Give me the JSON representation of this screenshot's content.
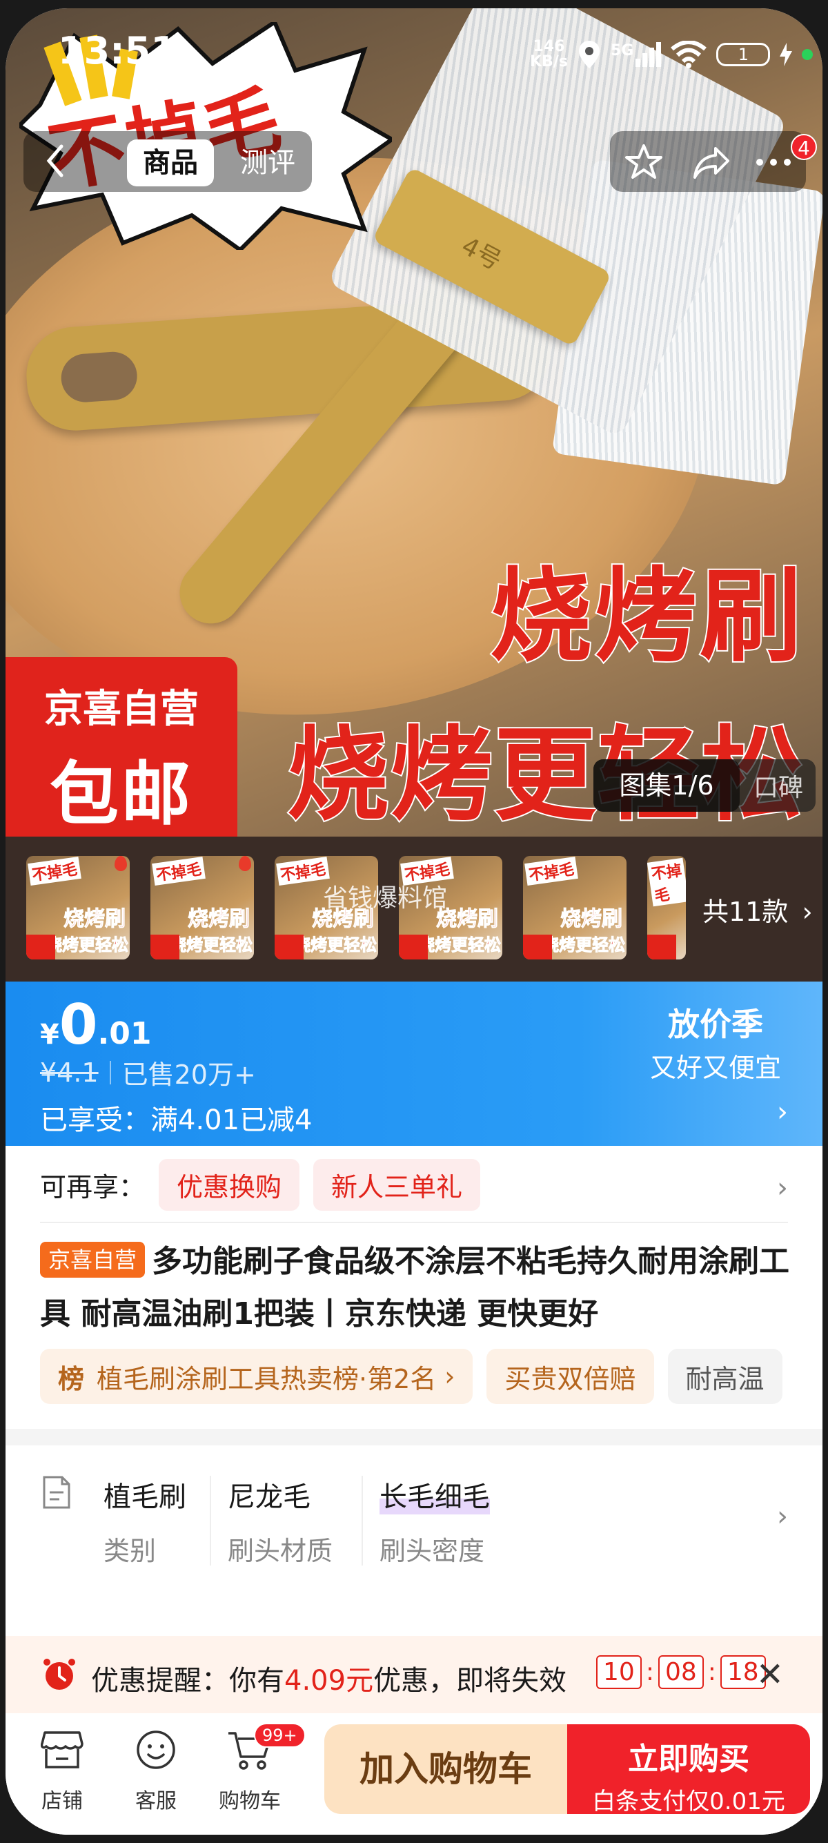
{
  "status": {
    "time": "13:51",
    "speed_value": "146",
    "speed_unit": "KB/s",
    "network": "5G",
    "battery": "1"
  },
  "hero": {
    "burst_text": "不掉毛",
    "headline1": "烧烤刷",
    "headline2": "烧烤更轻松",
    "brush_mark": "4号",
    "promo_line1": "京喜自营",
    "promo_line2": "包邮",
    "gallery_label": "图集1/6",
    "reviews_label": "口碑"
  },
  "topbar": {
    "tab_product": "商品",
    "tab_review": "测评",
    "notif_count": "4"
  },
  "sku": {
    "overlay": "省钱爆料馆",
    "count_label": "共11款",
    "thumb_tag": "不掉毛",
    "thumb_red1": "烧烤刷",
    "thumb_red2": "烧烤更轻松"
  },
  "price": {
    "yen": "¥",
    "integer": "0",
    "decimal": ".01",
    "original": "¥4.1",
    "sold": "已售20万+",
    "promo": "已享受：满4.01已减4",
    "season_title": "放价季",
    "season_sub": "又好又便宜"
  },
  "again": {
    "label": "可再享：",
    "tags": [
      "优惠换购",
      "新人三单礼"
    ]
  },
  "product": {
    "tag": "京喜自营",
    "title": "多功能刷子食品级不涂层不粘毛持久耐用涂刷工具 耐高温油刷1把装丨京东快递 更快更好"
  },
  "rank": {
    "bang": "榜",
    "rank_text": "植毛刷涂刷工具热卖榜·第2名",
    "chip2": "买贵双倍赔",
    "chip3": "耐高温"
  },
  "specs": [
    {
      "value": "植毛刷",
      "key": "类别"
    },
    {
      "value": "尼龙毛",
      "key": "刷头材质"
    },
    {
      "value": "长毛细毛",
      "key": "刷头密度"
    }
  ],
  "notice": {
    "prefix": "优惠提醒：你有",
    "amount": "4.09元",
    "suffix": "优惠，即将失效",
    "timer": [
      "10",
      "08",
      "18"
    ]
  },
  "bottom": {
    "shop": "店铺",
    "service": "客服",
    "cart": "购物车",
    "cart_badge": "99+",
    "add_cart": "加入购物车",
    "buy_now": "立即购买",
    "buy_sub": "白条支付仅0.01元"
  },
  "colors": {
    "accent_blue": "#1a8cf0",
    "accent_red": "#f0222a",
    "cart_bg": "#fde2c2"
  }
}
